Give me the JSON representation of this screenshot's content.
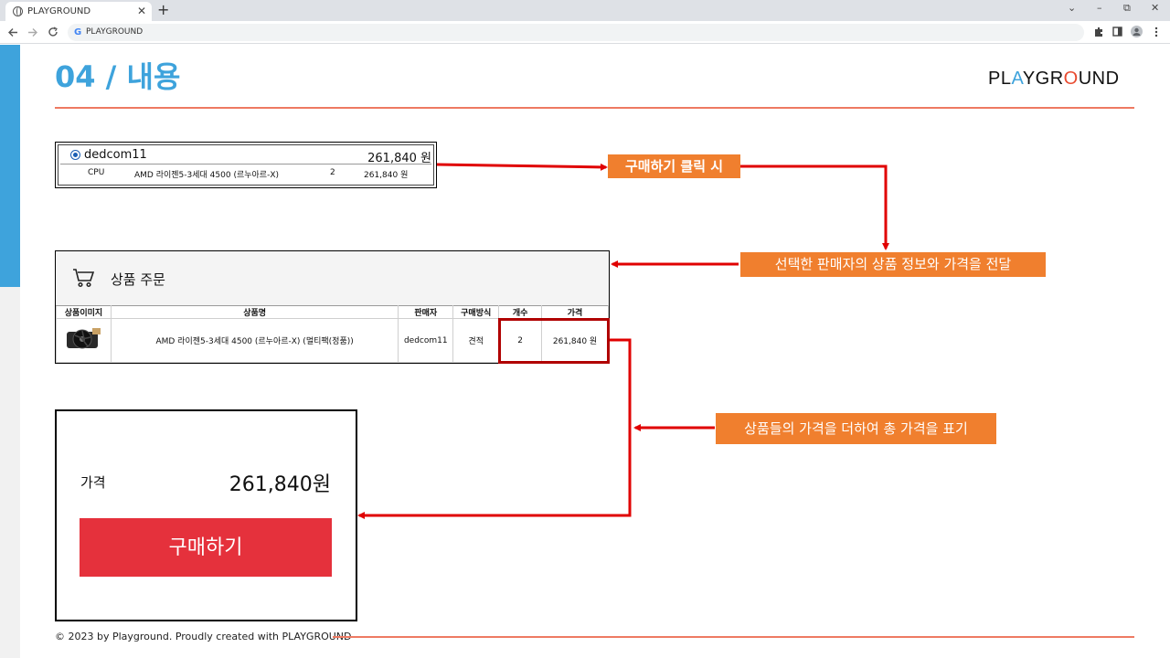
{
  "browser": {
    "tab_title": "PLAYGROUND",
    "tab_close": "✕",
    "new_tab": "+",
    "url": "PLAYGROUND",
    "window_controls": [
      "⌄",
      "–",
      "⧉",
      "✕"
    ]
  },
  "slide": {
    "title": "04 / 내용",
    "logo_before": "PL",
    "logo_a": "A",
    "logo_mid": "YGR",
    "logo_o": "O",
    "logo_after": "UND",
    "accent_color": "#3ea3dc",
    "line_color": "#ee7a62"
  },
  "seller": {
    "name": "dedcom11",
    "total": "261,840 원",
    "row": {
      "category": "CPU",
      "product": "AMD 라이젠5-3세대 4500 (르누아르-X)",
      "qty": "2",
      "price": "261,840 원"
    }
  },
  "order": {
    "title": "상품 주문",
    "headers": [
      "상품이미지",
      "상품명",
      "판매자",
      "구매방식",
      "개수",
      "가격"
    ],
    "row": {
      "product": "AMD 라이젠5-3세대 4500 (르누아르-X) (멀티팩(정품))",
      "seller": "dedcom11",
      "method": "견적",
      "qty": "2",
      "price": "261,840 원"
    }
  },
  "summary": {
    "price_label": "가격",
    "price_value": "261,840원",
    "buy_label": "구매하기",
    "buy_color": "#e5313c"
  },
  "callouts": {
    "click": "구매하기 클릭 시",
    "pass": "선택한 판매자의 상품 정보와 가격을 전달",
    "sum": "상품들의 가격을 더하여 총 가격을 표기"
  },
  "footer": {
    "text": "© 2023 by Playground. Proudly created with PLAYGROUND"
  }
}
